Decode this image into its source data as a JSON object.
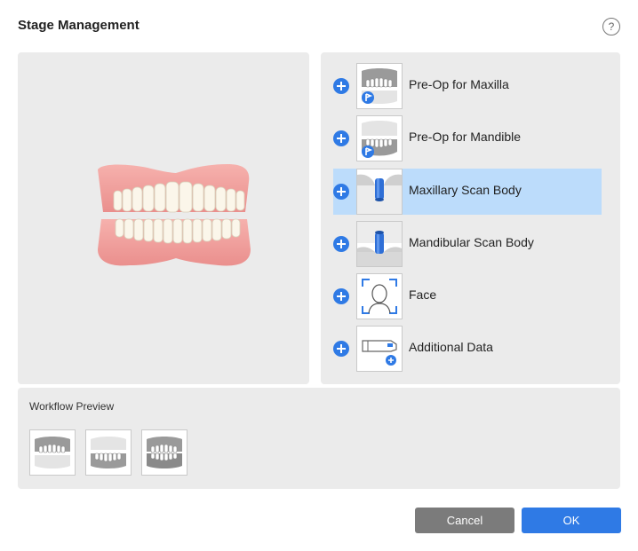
{
  "dialog": {
    "title": "Stage Management",
    "help_glyph": "?"
  },
  "stages": [
    {
      "label": "Pre-Op for Maxilla",
      "icon": "maxilla-preop-icon",
      "selected": false
    },
    {
      "label": "Pre-Op for Mandible",
      "icon": "mandible-preop-icon",
      "selected": false
    },
    {
      "label": "Maxillary Scan Body",
      "icon": "maxillary-scan-body-icon",
      "selected": true
    },
    {
      "label": "Mandibular Scan Body",
      "icon": "mandibular-scan-body-icon",
      "selected": false
    },
    {
      "label": "Face",
      "icon": "face-icon",
      "selected": false
    },
    {
      "label": "Additional Data",
      "icon": "additional-data-icon",
      "selected": false
    }
  ],
  "workflow": {
    "title": "Workflow Preview",
    "thumbnails": [
      "maxilla-preop-thumb",
      "mandible-preop-thumb",
      "occlusion-thumb"
    ]
  },
  "buttons": {
    "cancel": "Cancel",
    "ok": "OK"
  },
  "colors": {
    "accent": "#2f7ae5",
    "selected_row": "#bcdcfb",
    "panel": "#ebebeb",
    "cancel": "#7b7b7b",
    "gum": "#f2a3a3"
  }
}
